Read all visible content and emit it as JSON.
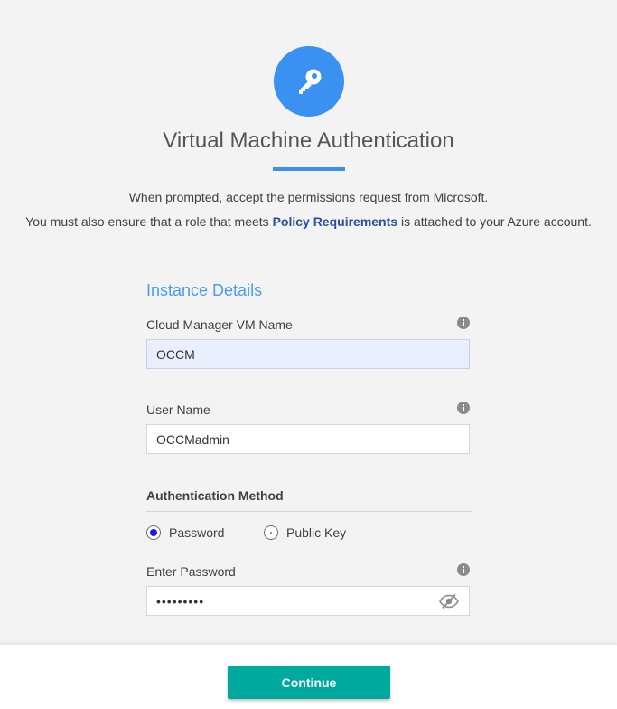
{
  "header": {
    "title": "Virtual Machine Authentication",
    "description_line1": "When prompted, accept the permissions request from Microsoft.",
    "description_line2_before": "You must also ensure that a role that meets",
    "description_line2_link": "Policy Requirements",
    "description_line2_after": "is attached to your Azure account."
  },
  "instance_details": {
    "section_title": "Instance Details",
    "vm_name": {
      "label": "Cloud Manager VM Name",
      "value": "OCCM"
    },
    "user_name": {
      "label": "User Name",
      "value": "OCCMadmin"
    }
  },
  "authentication": {
    "title": "Authentication Method",
    "options": [
      {
        "label": "Password",
        "selected": true
      },
      {
        "label": "Public Key",
        "selected": false
      }
    ],
    "password": {
      "label": "Enter Password",
      "value": "•••••••••"
    }
  },
  "footer": {
    "continue_label": "Continue"
  },
  "colors": {
    "accent": "#3b91f2",
    "link": "#2a4f9e",
    "primary_button": "#00a99d",
    "radio_selected": "#1a1ae0"
  },
  "icons": {
    "key": "key-icon",
    "info": "info-icon",
    "eye_slash": "eye-slash-icon"
  }
}
